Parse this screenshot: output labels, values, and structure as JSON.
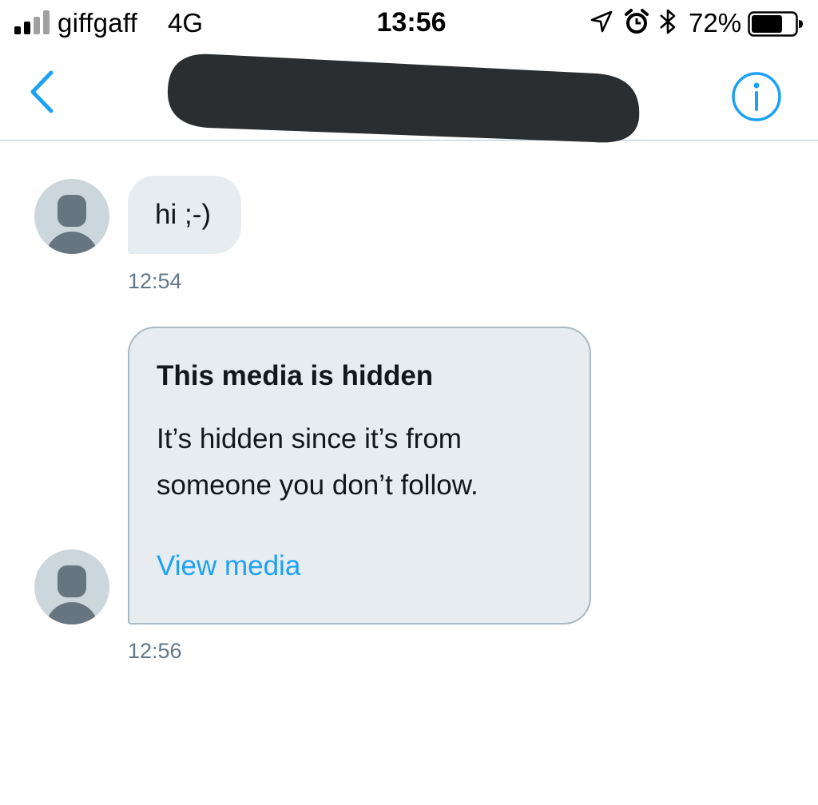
{
  "status_bar": {
    "carrier": "giffgaff",
    "network": "4G",
    "time": "13:56",
    "battery_percent": "72%",
    "signal_bars_filled": 2,
    "signal_bars_total": 4,
    "battery_level": 0.72,
    "icons": [
      "location-arrow-icon",
      "alarm-clock-icon",
      "bluetooth-icon",
      "battery-icon"
    ]
  },
  "header": {
    "back_icon": "chevron-left-icon",
    "info_icon": "info-circle-icon"
  },
  "messages": [
    {
      "type": "text",
      "text": "hi ;-)",
      "time": "12:54"
    },
    {
      "type": "hidden-media",
      "title": "This media is hidden",
      "description": "It’s hidden since it’s from someone you don’t follow.",
      "action": "View media",
      "time": "12:56"
    }
  ],
  "colors": {
    "accent": "#1da1f2",
    "bubble": "#e6ecf0",
    "avatar_bg": "#ccd6dd",
    "avatar_fg": "#66757f",
    "secondary_text": "#657786",
    "redaction": "#2a2e31"
  }
}
